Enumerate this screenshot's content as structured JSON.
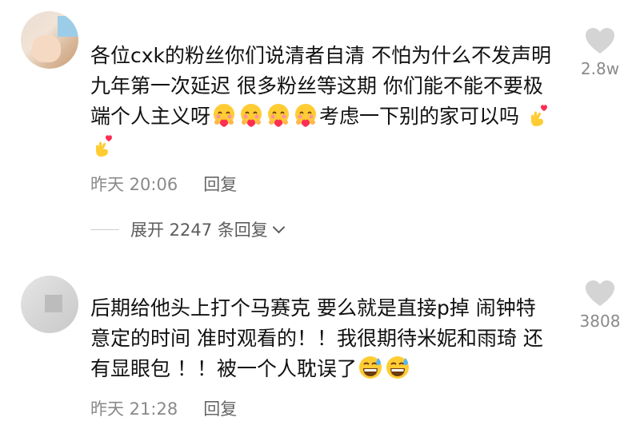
{
  "comments": [
    {
      "text_before": "各位cxk的粉丝你们说清者自清 不怕为什么不发声明 九年第一次延迟 很多粉丝等这期 你们能不能不要极端个人主义呀",
      "text_middle": "考虑一下别的家可以吗",
      "emoji_group_1": [
        "hugging-heart-emoji",
        "hugging-heart-emoji",
        "hugging-heart-emoji",
        "hugging-heart-emoji"
      ],
      "emoji_group_2": [
        "finger-heart-emoji",
        "finger-heart-emoji"
      ],
      "time": "昨天 20:06",
      "reply_label": "回复",
      "expand_label": "展开 2247 条回复",
      "likes": "2.8w"
    },
    {
      "text_before": "后期给他头上打个马赛克 要么就是直接p掉 闹钟特意定的时间 准时观看的！！我很期待米妮和雨琦 还有显眼包 ！！被一个人耽误了",
      "emoji_group_1": [
        "grinning-sweat-emoji",
        "grinning-sweat-emoji"
      ],
      "time": "昨天 21:28",
      "reply_label": "回复",
      "likes": "3808"
    }
  ],
  "icons": {
    "like": "heart-icon",
    "expand": "chevron-down-icon"
  },
  "colors": {
    "text": "#111111",
    "meta": "#8a8a8a",
    "heart": "#d4d4d4"
  }
}
